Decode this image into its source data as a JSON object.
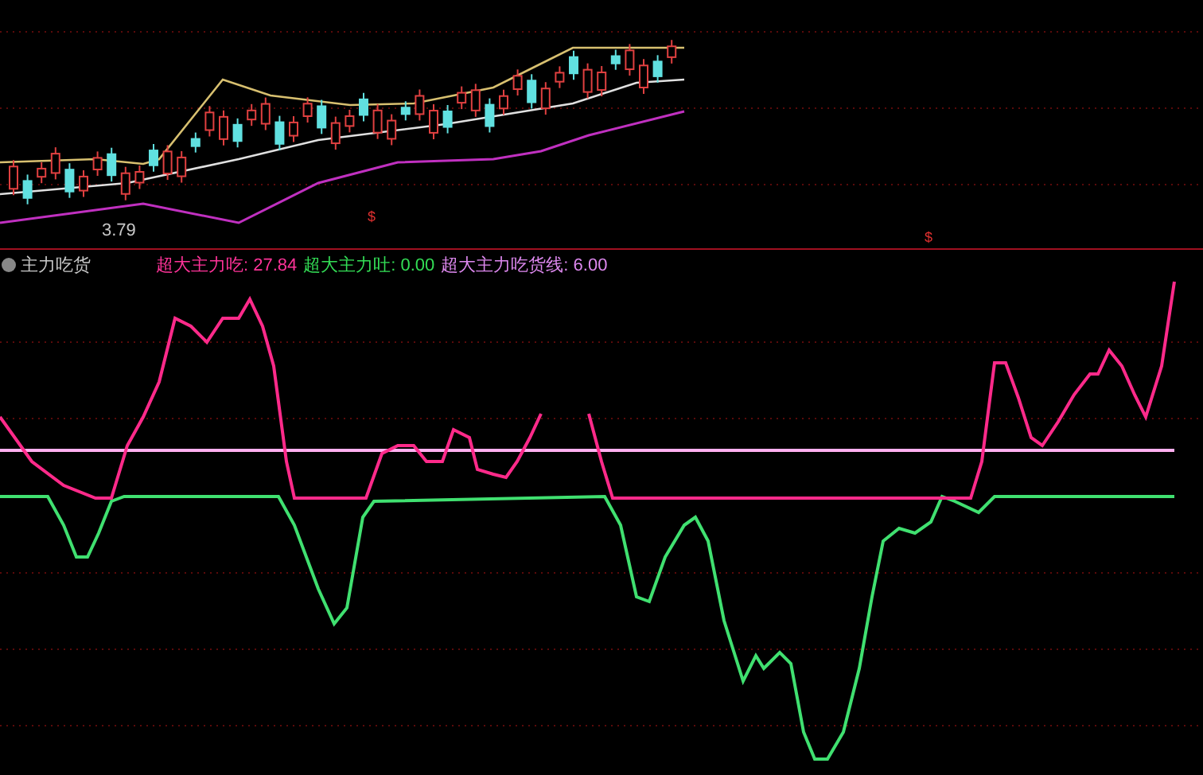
{
  "price_pane": {
    "price_label": "3.79",
    "markers": [
      "$",
      "$"
    ]
  },
  "indicator": {
    "name": "主力吃货",
    "legend": [
      {
        "label": "超大主力吃:",
        "value": "27.84",
        "color": "#ff3399"
      },
      {
        "label": "超大主力吐:",
        "value": "0.00",
        "color": "#33dd55"
      },
      {
        "label": "超大主力吃货线:",
        "value": "6.00",
        "color": "#dd88ee"
      }
    ]
  }
}
